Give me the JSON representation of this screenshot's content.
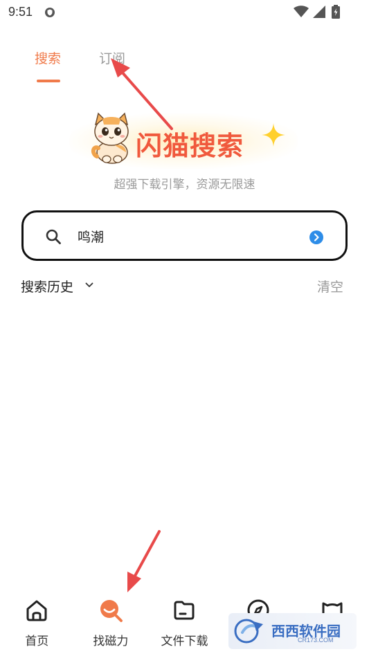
{
  "status_bar": {
    "time": "9:51"
  },
  "tabs": [
    {
      "label": "搜索",
      "active": true
    },
    {
      "label": "订阅",
      "active": false
    }
  ],
  "logo": {
    "text": "闪猫搜索"
  },
  "subtitle": "超强下载引擎，资源无限速",
  "search": {
    "value": "鸣潮"
  },
  "history": {
    "title": "搜索历史",
    "clear_label": "清空"
  },
  "bottom_nav": [
    {
      "label": "首页",
      "icon": "home-icon"
    },
    {
      "label": "找磁力",
      "icon": "magnet-search-icon"
    },
    {
      "label": "文件下载",
      "icon": "folder-icon"
    },
    {
      "label": "",
      "icon": "compass-icon"
    },
    {
      "label": "",
      "icon": "cat-icon"
    }
  ],
  "watermark": {
    "text": "西西软件园",
    "sub": "CR173.COM"
  },
  "colors": {
    "accent": "#f07a4a",
    "logo_red": "#f0593d",
    "annotation_arrow": "#e84a4a",
    "search_go": "#2e8de8"
  }
}
